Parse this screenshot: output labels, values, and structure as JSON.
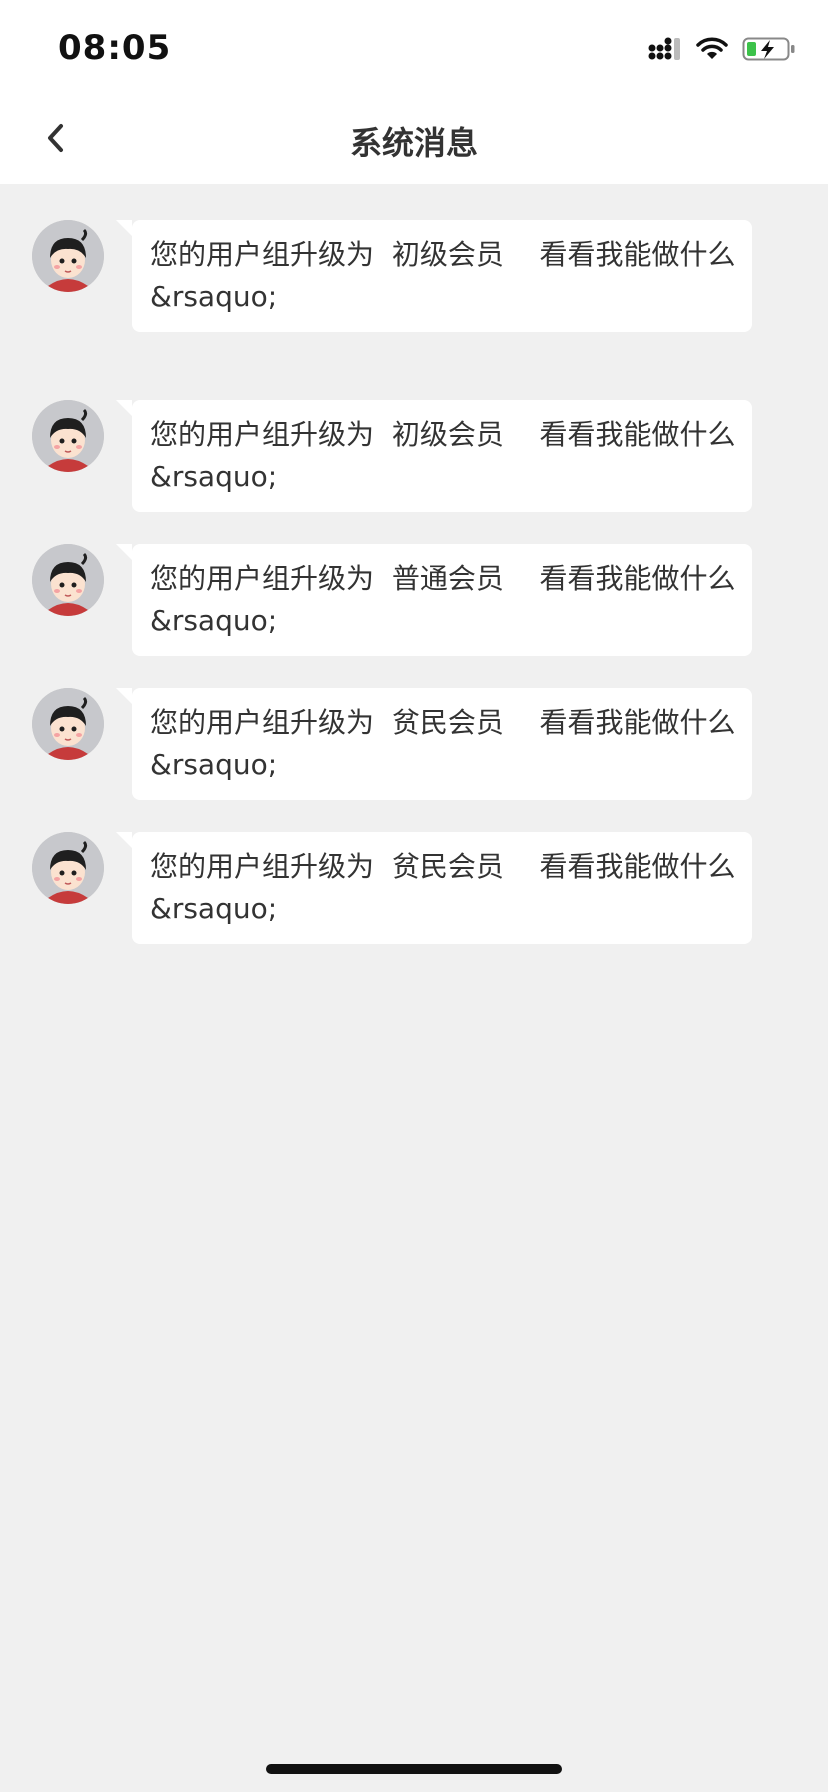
{
  "status_bar": {
    "time": "08:05"
  },
  "nav": {
    "title": "系统消息"
  },
  "messages": [
    {
      "prefix": "您的用户组升级为",
      "level": "初级会员",
      "suffix": "看看我能做什么",
      "entity": "&rsaquo;"
    },
    {
      "prefix": "您的用户组升级为",
      "level": "初级会员",
      "suffix": "看看我能做什么",
      "entity": "&rsaquo;"
    },
    {
      "prefix": "您的用户组升级为",
      "level": "普通会员",
      "suffix": "看看我能做什么",
      "entity": "&rsaquo;"
    },
    {
      "prefix": "您的用户组升级为",
      "level": "贫民会员",
      "suffix": "看看我能做什么",
      "entity": "&rsaquo;"
    },
    {
      "prefix": "您的用户组升级为",
      "level": "贫民会员",
      "suffix": "看看我能做什么",
      "entity": "&rsaquo;"
    }
  ],
  "icons": {
    "back": "chevron-left-icon",
    "signal": "cellular-signal-icon",
    "wifi": "wifi-icon",
    "battery": "battery-charging-icon",
    "avatar": "avatar-icon"
  }
}
